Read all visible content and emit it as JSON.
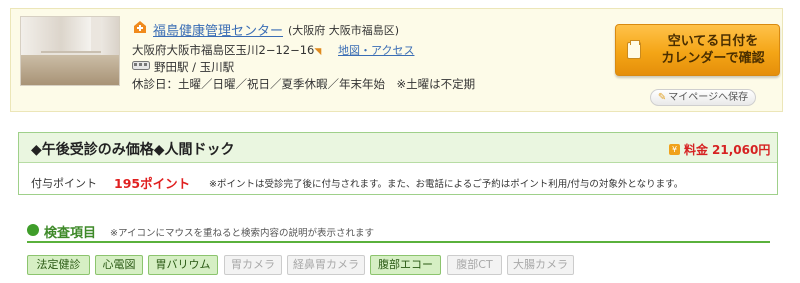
{
  "facility": {
    "name": "福島健康管理センター",
    "area": "(大阪府 大阪市福島区)",
    "address": "大阪府大阪市福島区玉川2−12−16",
    "map_link": "地図・アクセス",
    "station": "野田駅 / 玉川駅",
    "holidays": "休診日：土曜／日曜／祝日／夏季休暇／年末年始　※土曜は不定期"
  },
  "actions": {
    "calendar_button": "空いてる日付をカレンダーで確認",
    "calendar_line1": "空いてる日付を",
    "calendar_line2": "カレンダーで確認",
    "mypage_save": "マイページへ保存"
  },
  "course": {
    "title": "◆午後受診のみ価格◆人間ドック",
    "price_label": "料金",
    "price_value": "21,060円",
    "points_label": "付与ポイント",
    "points_value": "195ポイント",
    "points_note": "※ポイントは受診完了後に付与されます。また、お電話によるご予約はポイント利用/付与の対象外となります。"
  },
  "exam_items": {
    "title": "検査項目",
    "note": "※アイコンにマウスを重ねると検索内容の説明が表示されます",
    "tags": [
      {
        "label": "法定健診",
        "active": true
      },
      {
        "label": "心電図",
        "active": true
      },
      {
        "label": "胃バリウム",
        "active": true
      },
      {
        "label": "胃カメラ",
        "active": false
      },
      {
        "label": "経鼻胃カメラ",
        "active": false
      },
      {
        "label": "腹部エコー",
        "active": true
      },
      {
        "label": "腹部CT",
        "active": false
      },
      {
        "label": "大腸カメラ",
        "active": false
      }
    ]
  },
  "colors": {
    "link": "#3a6db5",
    "accent_orange": "#f4a516",
    "price_red": "#d62222",
    "green": "#5ab13c"
  },
  "icons": {
    "hospital": "hospital-icon",
    "train": "train-icon",
    "calendar": "calendar-icon",
    "pen": "pen-icon",
    "price": "price-icon",
    "pin": "pin-icon"
  }
}
